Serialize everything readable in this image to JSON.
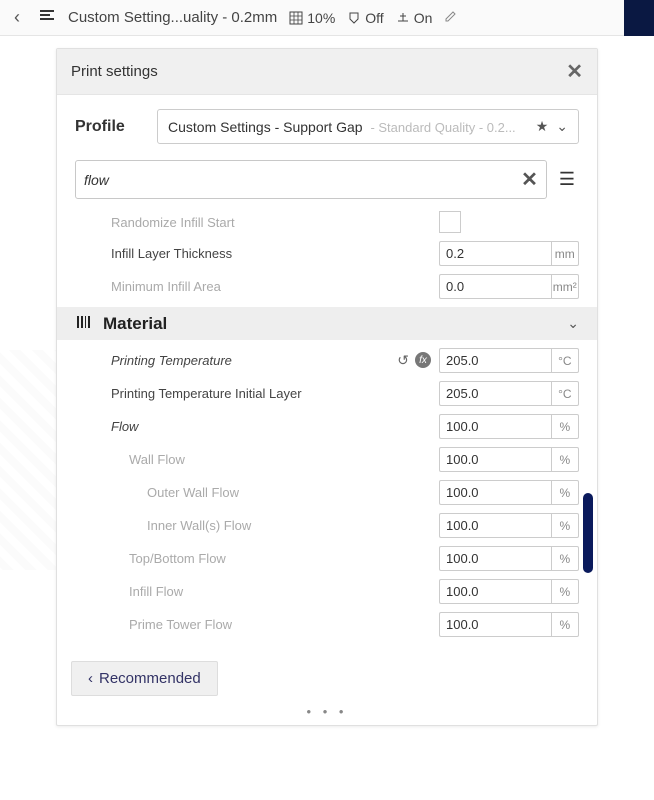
{
  "topbar": {
    "title": "Custom Setting...uality - 0.2mm",
    "infill": "10%",
    "support": "Off",
    "adhesion": "On"
  },
  "panel": {
    "title": "Print settings"
  },
  "profile": {
    "label": "Profile",
    "selected": "Custom Settings - Support Gap",
    "sub": "- Standard Quality - 0.2..."
  },
  "search": {
    "value": "flow"
  },
  "sections": [
    {
      "label": "Randomize Infill Start",
      "type": "checkbox",
      "faded": true,
      "indent": 1
    },
    {
      "label": "Infill Layer Thickness",
      "type": "number",
      "value": "0.2",
      "unit": "mm",
      "indent": 1
    },
    {
      "label": "Minimum Infill Area",
      "type": "number",
      "value": "0.0",
      "unit": "mm²",
      "faded": true,
      "indent": 1
    }
  ],
  "materialHeader": "Material",
  "materialSettings": [
    {
      "label": "Printing Temperature",
      "value": "205.0",
      "unit": "°C",
      "italic": true,
      "actions": true,
      "indent": 1
    },
    {
      "label": "Printing Temperature Initial Layer",
      "value": "205.0",
      "unit": "°C",
      "indent": 1
    },
    {
      "label": "Flow",
      "value": "100.0",
      "unit": "%",
      "italic": true,
      "indent": 1
    },
    {
      "label": "Wall Flow",
      "value": "100.0",
      "unit": "%",
      "faded": true,
      "indent": 2
    },
    {
      "label": "Outer Wall Flow",
      "value": "100.0",
      "unit": "%",
      "faded": true,
      "indent": 3
    },
    {
      "label": "Inner Wall(s) Flow",
      "value": "100.0",
      "unit": "%",
      "faded": true,
      "indent": 3
    },
    {
      "label": "Top/Bottom Flow",
      "value": "100.0",
      "unit": "%",
      "faded": true,
      "indent": 2
    },
    {
      "label": "Infill Flow",
      "value": "100.0",
      "unit": "%",
      "faded": true,
      "indent": 2
    },
    {
      "label": "Prime Tower Flow",
      "value": "100.0",
      "unit": "%",
      "faded": true,
      "indent": 2
    }
  ],
  "footer": {
    "recommended": "Recommended"
  }
}
